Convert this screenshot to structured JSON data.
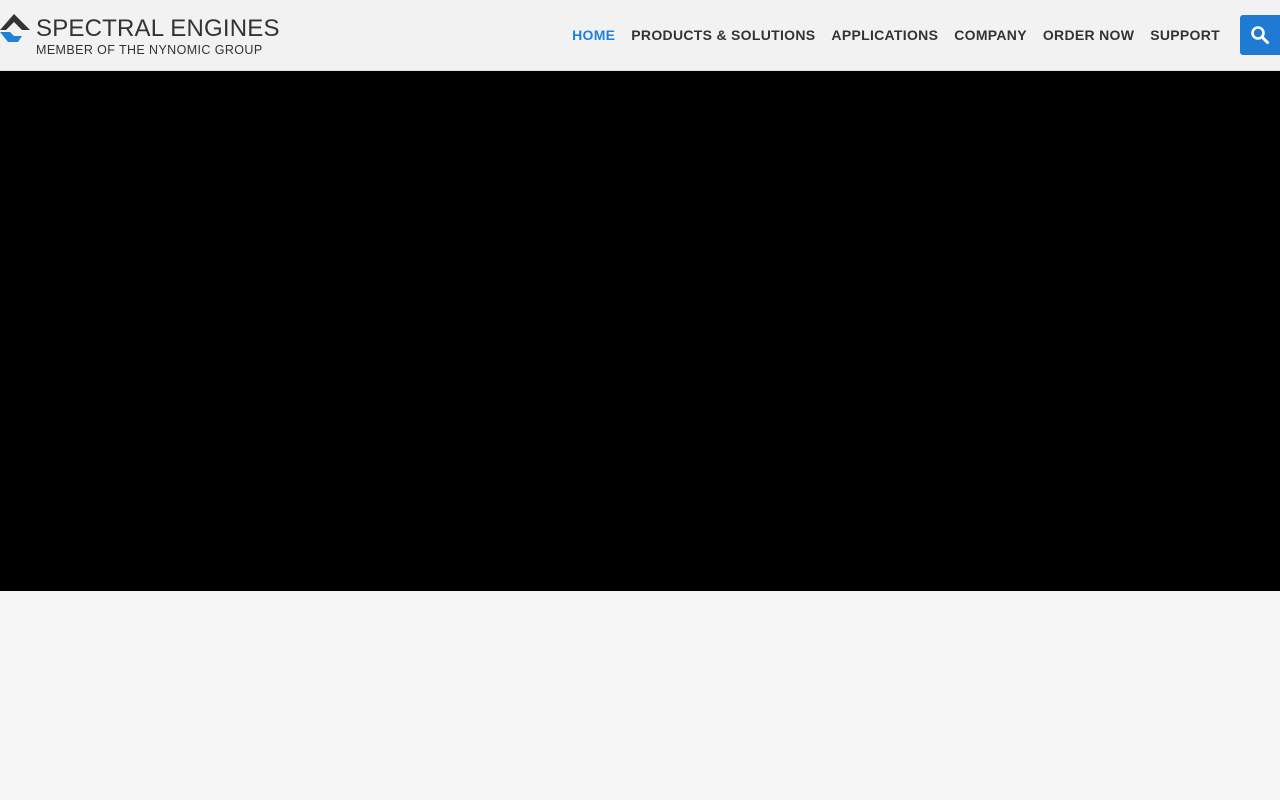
{
  "brand": {
    "name": "SPECTRAL ENGINES",
    "tagline": "MEMBER OF THE NYNOMIC GROUP",
    "colors": {
      "dark": "#333333",
      "accent": "#1f82d6"
    }
  },
  "nav": {
    "items": [
      {
        "label": "HOME",
        "active": true
      },
      {
        "label": "PRODUCTS & SOLUTIONS",
        "active": false
      },
      {
        "label": "APPLICATIONS",
        "active": false
      },
      {
        "label": "COMPANY",
        "active": false
      },
      {
        "label": "ORDER NOW",
        "active": false
      },
      {
        "label": "SUPPORT",
        "active": false
      }
    ],
    "search_icon": "search-icon"
  },
  "hero": {
    "background": "#000000"
  }
}
